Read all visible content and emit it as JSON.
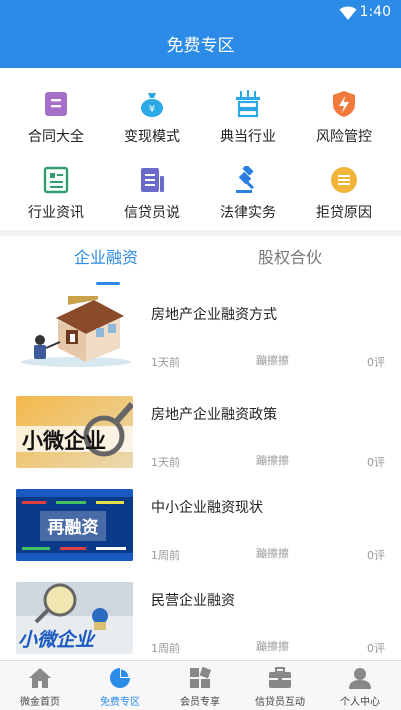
{
  "status": {
    "time": "1:40"
  },
  "header": {
    "title": "免费专区"
  },
  "grid": {
    "items": [
      {
        "label": "合同大全",
        "icon": "contract-icon",
        "color": "#a66fc9"
      },
      {
        "label": "变现模式",
        "icon": "money-bag-icon",
        "color": "#2aa9e6"
      },
      {
        "label": "典当行业",
        "icon": "pawn-icon",
        "color": "#2aa9e6"
      },
      {
        "label": "风险管控",
        "icon": "shield-lightning-icon",
        "color": "#f07a3c"
      },
      {
        "label": "行业资讯",
        "icon": "news-icon",
        "color": "#2e9e6c"
      },
      {
        "label": "信贷员说",
        "icon": "document-icon",
        "color": "#6a6acb"
      },
      {
        "label": "法律实务",
        "icon": "gavel-icon",
        "color": "#2b7fe0"
      },
      {
        "label": "拒贷原因",
        "icon": "list-circle-icon",
        "color": "#f2b33a"
      }
    ]
  },
  "tabs": {
    "active": "企业融资",
    "other": "股权合伙"
  },
  "articles": [
    {
      "title": "房地产企业融资方式",
      "ago": "1天前",
      "source": "蹦擦擦",
      "comments": "0评",
      "thumb_text": ""
    },
    {
      "title": "房地产企业融资政策",
      "ago": "1天前",
      "source": "蹦擦擦",
      "comments": "0评",
      "thumb_text": "小微企业"
    },
    {
      "title": "中小企业融资现状",
      "ago": "1周前",
      "source": "蹦擦擦",
      "comments": "0评",
      "thumb_text": "再融资"
    },
    {
      "title": "民营企业融资",
      "ago": "1周前",
      "source": "蹦擦擦",
      "comments": "0评",
      "thumb_text": "小微企业"
    }
  ],
  "bottom_nav": [
    {
      "label": "微金首页",
      "icon": "home-icon"
    },
    {
      "label": "免费专区",
      "icon": "pie-chart-icon"
    },
    {
      "label": "会员专享",
      "icon": "blocks-icon"
    },
    {
      "label": "信贷员互动",
      "icon": "briefcase-icon"
    },
    {
      "label": "个人中心",
      "icon": "person-icon"
    }
  ],
  "colors": {
    "accent": "#2b8be6"
  }
}
